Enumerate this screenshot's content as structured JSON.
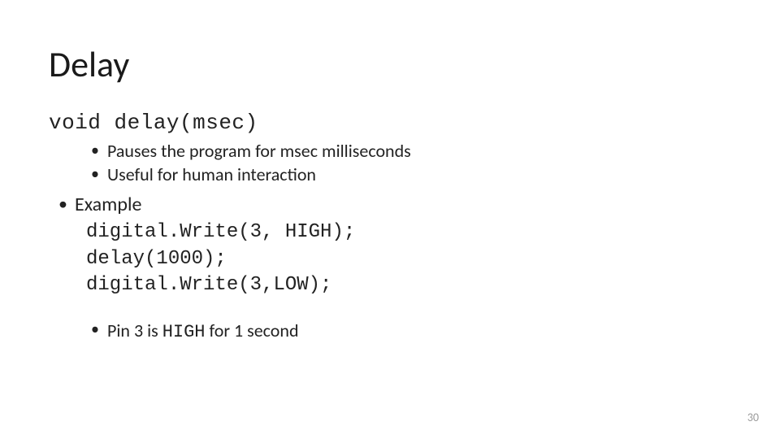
{
  "slide": {
    "title": "Delay",
    "signature": "void delay(msec)",
    "signature_bullets": [
      "Pauses the program for msec milliseconds",
      "Useful for human interaction"
    ],
    "example_label": "Example",
    "code_lines": [
      "digital.Write(3, HIGH);",
      "delay(1000);",
      "digital.Write(3,LOW);"
    ],
    "pin_note_prefix": "Pin 3 is ",
    "pin_note_code": "HIGH",
    "pin_note_suffix": " for 1 second",
    "page_number": "30"
  }
}
